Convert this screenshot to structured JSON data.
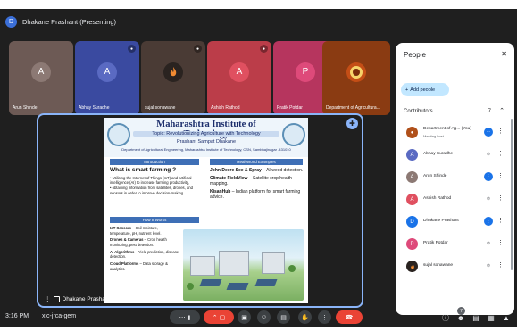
{
  "header": {
    "avatar_letter": "D",
    "title": "Dhakane Prashant (Presenting)"
  },
  "tiles": [
    {
      "name": "Arun Shinde",
      "letter": "A",
      "bg": "#6d5a55",
      "avatar_bg": "#8c7974",
      "muted": false
    },
    {
      "name": "Abhay Suradhe",
      "letter": "A",
      "bg": "#3a4aa0",
      "avatar_bg": "#5a6ac2",
      "muted": true
    },
    {
      "name": "sujal sonawane",
      "letter": "",
      "bg": "#4a3b35",
      "avatar_bg": "#2a2320",
      "muted": true
    },
    {
      "name": "Ashish Rathod",
      "letter": "A",
      "bg": "#bb3d49",
      "avatar_bg": "#e05060",
      "muted": true
    },
    {
      "name": "Pratik Potdar",
      "letter": "P",
      "bg": "#b6355e",
      "avatar_bg": "#de4a7a",
      "muted": true
    },
    {
      "name": "Department of Agricultura...",
      "letter": "",
      "bg": "#8a3b12",
      "avatar_bg": "#c44e16",
      "muted": false
    }
  ],
  "stage": {
    "presenter_label": "Dhakane Prashant"
  },
  "slide": {
    "title": "Maharashtra Institute of Technology",
    "subtitle": "Topic: Revolutionizing Agriculture with Technology",
    "author": "Prashant Sampat Dhakane",
    "dept": "Department of Agricultural Engineering, Maharashtra Institute of Technology, CSN, Sambhajinagar -431010",
    "intro_bar": "Introduction",
    "smart_heading": "What is smart farming ?",
    "smart_bullets": [
      "Utilising the Internet of Things (IoT) and artificial intelligence (AI) to increase farming productivity,",
      "obtaining information from satellites, drones, and sensors in order to improve decision-making."
    ],
    "how_bar": "How It Works",
    "how_items": [
      {
        "label": "IoT Sensors",
        "text": " – Soil moisture, temperature, pH, nutrient level."
      },
      {
        "label": "Drones & Cameras",
        "text": " – Crop health monitoring, pest detection."
      },
      {
        "label": "AI Algorithms",
        "text": " – Yield prediction, disease detection."
      },
      {
        "label": "Cloud Platforms",
        "text": " – Data storage & analytics."
      }
    ],
    "examples_bar": "Real-World Examples",
    "examples": [
      {
        "label": "John Deere See & Spray",
        "text": " – AI weed detection."
      },
      {
        "label": "Climate FieldView",
        "text": " – Satellite crop health mapping."
      },
      {
        "label": "KisanHub",
        "text": " – Indian platform for smart farming advice."
      }
    ]
  },
  "people": {
    "title": "People",
    "add_label": "Add people",
    "section": "Contributors",
    "count": "7",
    "list": [
      {
        "name": "Department of Ag... (You)",
        "sub": "Meeting host",
        "letter": "",
        "avatar_bg": "#b0501a",
        "status": "more"
      },
      {
        "name": "Abhay Suradhe",
        "letter": "A",
        "avatar_bg": "#5a6ac2",
        "status": "muted"
      },
      {
        "name": "Arun Shinde",
        "letter": "A",
        "avatar_bg": "#8c7974",
        "status": "active"
      },
      {
        "name": "Ashish Rathod",
        "letter": "A",
        "avatar_bg": "#e05060",
        "status": "muted"
      },
      {
        "name": "Dhakane Prashant",
        "letter": "D",
        "avatar_bg": "#1a73e8",
        "status": "active"
      },
      {
        "name": "Pratik Potdar",
        "letter": "P",
        "avatar_bg": "#de4a7a",
        "status": "muted"
      },
      {
        "name": "sujal sonawane",
        "letter": "",
        "avatar_bg": "#2a2320",
        "status": "muted"
      }
    ]
  },
  "bottom": {
    "time": "3:16 PM",
    "code": "xic-jrca-gem",
    "people_badge": "7"
  },
  "colors": {
    "bg": "#1f1f1f",
    "accent": "#8ab4f8",
    "hangup": "#ea4335"
  }
}
